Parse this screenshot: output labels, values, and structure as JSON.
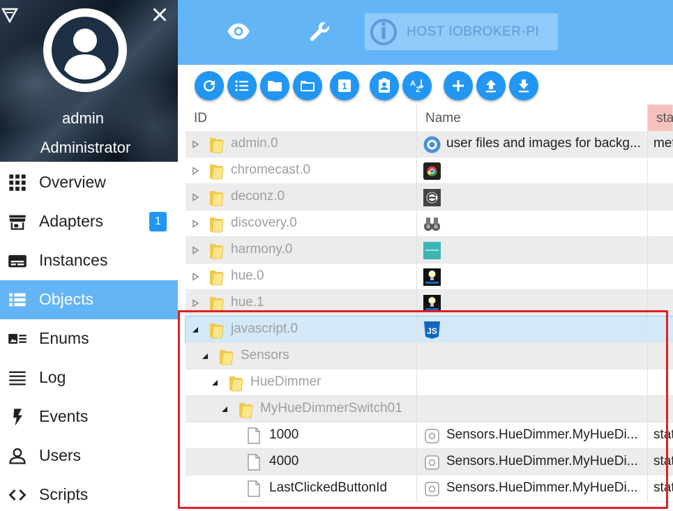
{
  "user": {
    "name": "admin",
    "role": "Administrator"
  },
  "nav": {
    "items": [
      {
        "label": "Overview",
        "icon": "grid-icon"
      },
      {
        "label": "Adapters",
        "icon": "store-icon",
        "badge": "1"
      },
      {
        "label": "Instances",
        "icon": "instances-icon"
      },
      {
        "label": "Objects",
        "icon": "list-icon",
        "active": true
      },
      {
        "label": "Enums",
        "icon": "enums-icon"
      },
      {
        "label": "Log",
        "icon": "log-icon"
      },
      {
        "label": "Events",
        "icon": "bolt-icon"
      },
      {
        "label": "Users",
        "icon": "user-icon"
      },
      {
        "label": "Scripts",
        "icon": "code-icon"
      }
    ]
  },
  "topbar": {
    "host_label": "HOST IOBROKER-PI",
    "icons": [
      "eye-icon",
      "wrench-icon"
    ]
  },
  "toolbar": {
    "buttons": [
      "refresh-icon",
      "list-view-icon",
      "folder-closed-icon",
      "folder-open-icon",
      "counter-icon",
      "contact-icon",
      "sort-az-icon",
      "add-icon",
      "upload-icon",
      "download-icon"
    ],
    "counter_label": "1"
  },
  "table": {
    "headers": {
      "id": "ID",
      "name": "Name",
      "state": "sta"
    },
    "rows": [
      {
        "id": "admin.0",
        "name": "user files and images for backg...",
        "state": "met",
        "icon": "gear-logo-icon",
        "kind": "folder",
        "level": 0
      },
      {
        "id": "chromecast.0",
        "name": "",
        "state": "",
        "icon": "chromecast-logo-icon",
        "kind": "folder",
        "level": 0
      },
      {
        "id": "deconz.0",
        "name": "",
        "state": "",
        "icon": "deconz-logo-icon",
        "kind": "folder",
        "level": 0
      },
      {
        "id": "discovery.0",
        "name": "",
        "state": "",
        "icon": "binoculars-logo-icon",
        "kind": "folder",
        "level": 0
      },
      {
        "id": "harmony.0",
        "name": "",
        "state": "",
        "icon": "harmony-logo-icon",
        "kind": "folder",
        "level": 0
      },
      {
        "id": "hue.0",
        "name": "",
        "state": "",
        "icon": "hue-logo-icon",
        "kind": "folder",
        "level": 0
      },
      {
        "id": "hue.1",
        "name": "",
        "state": "",
        "icon": "hue-logo-icon",
        "kind": "folder",
        "level": 0
      },
      {
        "id": "javascript.0",
        "name": "",
        "state": "",
        "icon": "js-logo-icon",
        "kind": "folder",
        "level": 0,
        "expanded": true,
        "selected": true
      },
      {
        "id": "Sensors",
        "name": "",
        "state": "",
        "kind": "folder",
        "level": 1,
        "expanded": true
      },
      {
        "id": "HueDimmer",
        "name": "",
        "state": "",
        "kind": "folder",
        "level": 2,
        "expanded": true
      },
      {
        "id": "MyHueDimmerSwitch01",
        "name": "",
        "state": "",
        "kind": "folder",
        "level": 3,
        "expanded": true
      },
      {
        "id": "1000",
        "name": "Sensors.HueDimmer.MyHueDi...",
        "state": "stat",
        "icon": "state-icon",
        "kind": "file",
        "level": 4
      },
      {
        "id": "4000",
        "name": "Sensors.HueDimmer.MyHueDi...",
        "state": "stat",
        "icon": "state-icon",
        "kind": "file",
        "level": 4
      },
      {
        "id": "LastClickedButtonId",
        "name": "Sensors.HueDimmer.MyHueDi...",
        "state": "stat",
        "icon": "state-icon",
        "kind": "file",
        "level": 4
      }
    ]
  },
  "colors": {
    "primary": "#2196f3",
    "topbar": "#64b5f6",
    "active_nav": "#64b5f6",
    "highlight": "#e01f26",
    "state_header": "#f7c2bd"
  }
}
